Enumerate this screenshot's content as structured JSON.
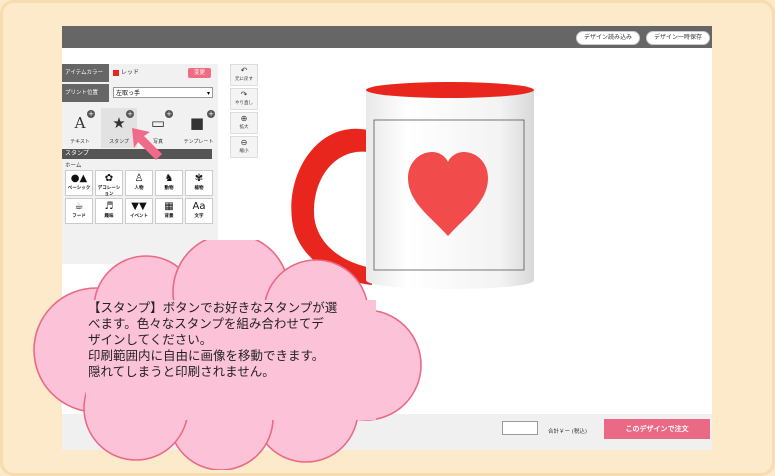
{
  "toolbar": {
    "load_design": "デザイン読み込み",
    "save_design": "デザイン一時保存"
  },
  "sidebar": {
    "item_color_label": "アイテムカラー",
    "item_color_value": "レッド",
    "change_button": "変更",
    "print_position_label": "プリント位置",
    "print_position_value": "左取っ手",
    "tools": [
      {
        "label": "テキスト",
        "icon": "text-icon"
      },
      {
        "label": "スタンプ",
        "icon": "stamp-icon"
      },
      {
        "label": "写真",
        "icon": "photo-icon"
      },
      {
        "label": "テンプレート",
        "icon": "template-folder-icon"
      }
    ],
    "stamp_header": "スタンプ",
    "home_label": "ホーム",
    "stamps": [
      {
        "label": "ベーシック",
        "icon": "basic-shapes-icon"
      },
      {
        "label": "デコレーション",
        "icon": "decoration-icon"
      },
      {
        "label": "人物",
        "icon": "person-icon"
      },
      {
        "label": "動物",
        "icon": "animal-icon"
      },
      {
        "label": "植物",
        "icon": "plant-icon"
      },
      {
        "label": "フード",
        "icon": "food-icon"
      },
      {
        "label": "趣味",
        "icon": "hobby-icon"
      },
      {
        "label": "イベント",
        "icon": "event-icon"
      },
      {
        "label": "背景",
        "icon": "background-icon"
      },
      {
        "label": "文字",
        "icon": "letters-icon"
      }
    ]
  },
  "view_tools": [
    {
      "label": "元に戻す",
      "icon": "undo-icon"
    },
    {
      "label": "やり直し",
      "icon": "redo-icon"
    },
    {
      "label": "拡大",
      "icon": "zoom-in-icon"
    },
    {
      "label": "縮小",
      "icon": "zoom-out-icon"
    }
  ],
  "footer": {
    "total_label": "合計￥ー (税込)",
    "order_button": "このデザインで注文"
  },
  "callout": {
    "lines": [
      "【スタンプ】ボタンでお好きなスタンプが選",
      "べます。色々なスタンプを組み合わせてデ",
      "ザインしてください。",
      "印刷範囲内に自由に画像を移動できます。",
      "隠れてしまうと印刷されません。"
    ]
  },
  "colors": {
    "mug_red": "#e8261e",
    "heart": "#f24b4b",
    "accent_pink": "#ea6a86",
    "cloud_fill": "#fcc3d8"
  }
}
